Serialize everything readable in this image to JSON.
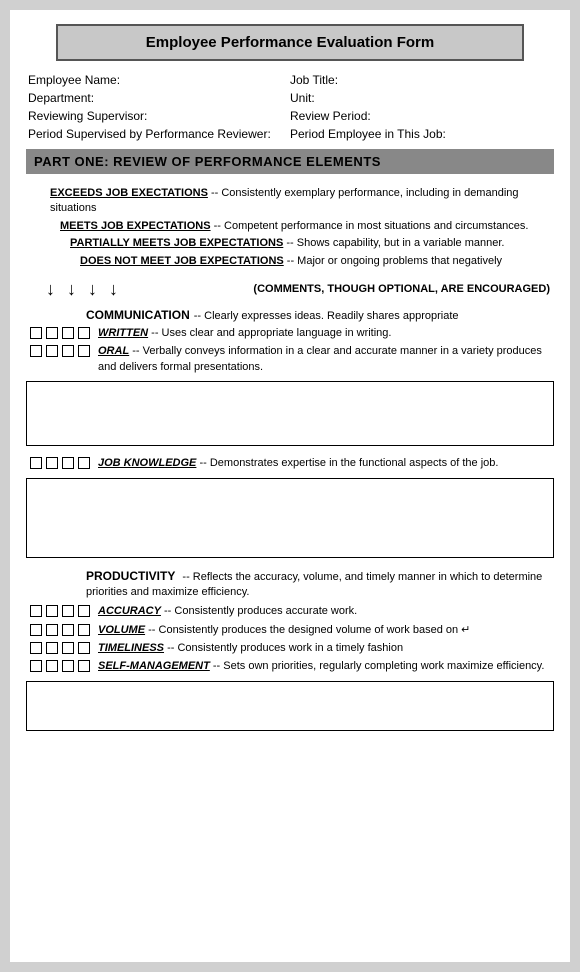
{
  "title": "Employee Performance Evaluation Form",
  "fields": {
    "employee_name_label": "Employee Name:",
    "job_title_label": "Job Title:",
    "department_label": "Department:",
    "unit_label": "Unit:",
    "reviewing_supervisor_label": "Reviewing Supervisor:",
    "review_period_label": "Review Period:",
    "period_supervised_label": "Period Supervised by Performance Reviewer:",
    "period_employee_label": "Period Employee in This Job:"
  },
  "part_one": {
    "header": "PART ONE: REVIEW OF PERFORMANCE ELEMENTS",
    "legend": [
      {
        "id": "exceeds",
        "bold_text": "EXCEEDS JOB EXECTATIONS",
        "rest": " -- Consistently exemplary performance, including in demanding situations"
      },
      {
        "id": "meets",
        "bold_text": "MEETS JOB EXPECTATIONS",
        "rest": " -- Competent performance in most situations and circumstances."
      },
      {
        "id": "partially",
        "bold_text": "PARTIALLY MEETS JOB EXPECTATIONS",
        "rest": " -- Shows capability, but in a variable manner."
      },
      {
        "id": "does_not",
        "bold_text": "DOES NOT MEET JOB EXPECTATIONS",
        "rest": " -- Major or ongoing problems that negatively"
      }
    ],
    "comments_note": "(COMMENTS, THOUGH OPTIONAL, ARE ENCOURAGED)",
    "sections": [
      {
        "id": "communication",
        "title": "COMMUNICATION",
        "desc": "-- Clearly expresses ideas. Readily shares appropriate",
        "items": [
          {
            "id": "written",
            "name": "WRITTEN",
            "desc": "-- Uses clear and appropriate language in writing."
          },
          {
            "id": "oral",
            "name": "ORAL",
            "desc": "-- Verbally conveys information in a clear and accurate manner in a variety produces and delivers formal presentations."
          }
        ],
        "has_textarea": true
      },
      {
        "id": "job_knowledge",
        "title": "JOB KNOWLEDGE",
        "desc": "-- Demonstrates expertise in the functional aspects of the job.",
        "items": [],
        "has_textarea": true,
        "single_checkbox_row": true
      },
      {
        "id": "productivity",
        "title": "PRODUCTIVITY",
        "desc": "-- Reflects the accuracy, volume, and timely manner in which to determine priorities and maximize efficiency.",
        "items": [
          {
            "id": "accuracy",
            "name": "ACCURACY",
            "desc": "-- Consistently produces accurate work."
          },
          {
            "id": "volume",
            "name": "VOLUME",
            "desc": "-- Consistently produces the designed volume of work based on ↵"
          },
          {
            "id": "timeliness",
            "name": "TIMELINESS",
            "desc": "-- Consistently produces work in a timely fashion"
          },
          {
            "id": "self_management",
            "name": "SELF-MANAGEMENT",
            "desc": "-- Sets own priorities, regularly completing work maximize efficiency."
          }
        ],
        "has_textarea": true
      }
    ]
  }
}
